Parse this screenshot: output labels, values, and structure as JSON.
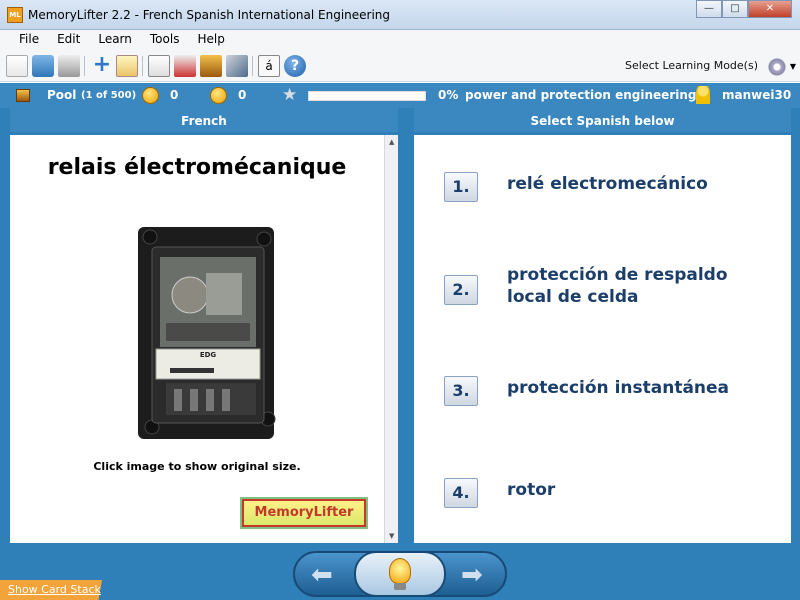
{
  "window": {
    "app_icon_text": "ML",
    "title": "MemoryLifter 2.2 - French Spanish International Engineering",
    "minimize": "—",
    "maximize": "□",
    "close": "✕"
  },
  "menu": [
    "File",
    "Edit",
    "Learn",
    "Tools",
    "Help"
  ],
  "toolbar": {
    "select_learning_modes": "Select Learning Mode(s)",
    "accent_char": "á",
    "help_char": "?",
    "icons": [
      "new-icon",
      "open-icon",
      "print-icon",
      "add-card-icon",
      "edit-card-icon",
      "slideshow-icon",
      "stats-icon",
      "card-stack-icon",
      "tools-icon",
      "special-char-icon",
      "help-icon",
      "gear-icon"
    ]
  },
  "status": {
    "pool_label": "Pool",
    "pool_count": "(1 of 500)",
    "correct": "0",
    "wrong": "0",
    "progress_text": "0%",
    "progress_fraction": 0,
    "topic": "power and protection engineering",
    "user": "manwei30"
  },
  "columns": {
    "left_header": "French",
    "right_header": "Select Spanish below"
  },
  "question": {
    "word": "relais électromécanique",
    "caption": "Click image to show original size.",
    "logo_text": "MemoryLifter",
    "relay_label": "EDG"
  },
  "answers": [
    {
      "num": "1.",
      "text": "relé electromecánico"
    },
    {
      "num": "2.",
      "text": "protección de respaldo local de celda"
    },
    {
      "num": "3.",
      "text": "protección instantánea"
    },
    {
      "num": "4.",
      "text": "rotor"
    }
  ],
  "bottom": {
    "show_card_stack": "Show Card Stack",
    "prev_arrow": "⬅",
    "next_arrow": "➡"
  },
  "colors": {
    "frame_blue": "#2f80b8",
    "status_blue": "#3b87c0",
    "answer_text": "#1b3e6a",
    "stack_orange": "#f2a33a"
  }
}
